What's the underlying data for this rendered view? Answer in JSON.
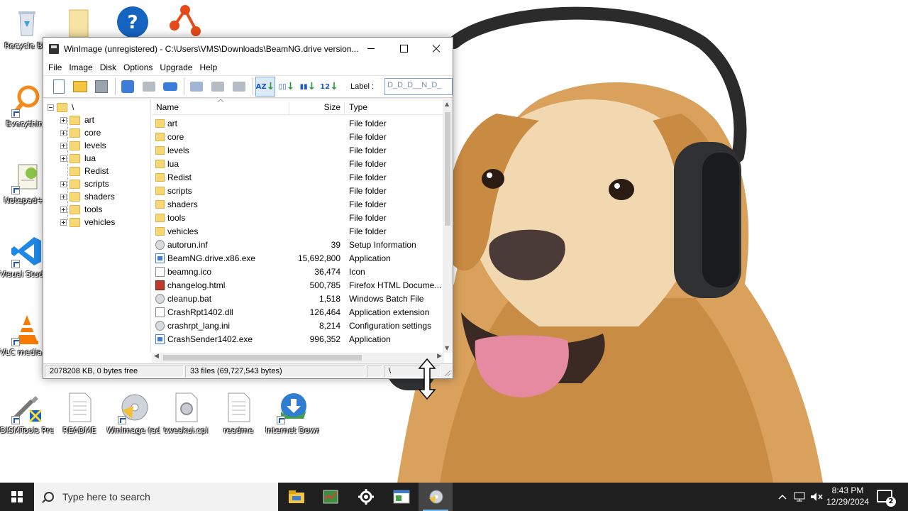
{
  "window": {
    "title": "WinImage (unregistered) - C:\\Users\\VMS\\Downloads\\BeamNG.drive version...",
    "menu": [
      "File",
      "Image",
      "Disk",
      "Options",
      "Upgrade",
      "Help"
    ],
    "label_caption": "Label :",
    "label_value": "D_D_D__N_D_"
  },
  "tree": {
    "root": "\\",
    "items": [
      "art",
      "core",
      "levels",
      "lua",
      "Redist",
      "scripts",
      "shaders",
      "tools",
      "vehicles"
    ]
  },
  "list": {
    "headers": {
      "name": "Name",
      "size": "Size",
      "type": "Type"
    },
    "rows": [
      {
        "name": "art",
        "size": "",
        "type": "File folder",
        "icon": "folder"
      },
      {
        "name": "core",
        "size": "",
        "type": "File folder",
        "icon": "folder"
      },
      {
        "name": "levels",
        "size": "",
        "type": "File folder",
        "icon": "folder"
      },
      {
        "name": "lua",
        "size": "",
        "type": "File folder",
        "icon": "folder"
      },
      {
        "name": "Redist",
        "size": "",
        "type": "File folder",
        "icon": "folder"
      },
      {
        "name": "scripts",
        "size": "",
        "type": "File folder",
        "icon": "folder"
      },
      {
        "name": "shaders",
        "size": "",
        "type": "File folder",
        "icon": "folder"
      },
      {
        "name": "tools",
        "size": "",
        "type": "File folder",
        "icon": "folder"
      },
      {
        "name": "vehicles",
        "size": "",
        "type": "File folder",
        "icon": "folder"
      },
      {
        "name": "autorun.inf",
        "size": "39",
        "type": "Setup Information",
        "icon": "gear"
      },
      {
        "name": "BeamNG.drive.x86.exe",
        "size": "15,692,800",
        "type": "Application",
        "icon": "exe"
      },
      {
        "name": "beamng.ico",
        "size": "36,474",
        "type": "Icon",
        "icon": "file"
      },
      {
        "name": "changelog.html",
        "size": "500,785",
        "type": "Firefox HTML Docume...",
        "icon": "html"
      },
      {
        "name": "cleanup.bat",
        "size": "1,518",
        "type": "Windows Batch File",
        "icon": "gear"
      },
      {
        "name": "CrashRpt1402.dll",
        "size": "126,464",
        "type": "Application extension",
        "icon": "file"
      },
      {
        "name": "crashrpt_lang.ini",
        "size": "8,214",
        "type": "Configuration settings",
        "icon": "gear"
      },
      {
        "name": "CrashSender1402.exe",
        "size": "996,352",
        "type": "Application",
        "icon": "exe"
      }
    ]
  },
  "status": {
    "free": "2078208 KB, 0 bytes free",
    "files": "33 files (69,727,543 bytes)",
    "path": "\\"
  },
  "desktop_icons": [
    {
      "label": "Recycle Bin",
      "icon": "recycle-bin-icon"
    },
    {
      "label": "Everything",
      "icon": "magnifier-icon"
    },
    {
      "label": "Notepad++",
      "icon": "notepad-icon"
    },
    {
      "label": "Visual Studio Code",
      "icon": "vscode-icon"
    },
    {
      "label": "VLC media player",
      "icon": "vlc-icon"
    },
    {
      "label": "DISMTools Preview",
      "icon": "tools-icon"
    },
    {
      "label": "README",
      "icon": "text-file-icon"
    },
    {
      "label": "WinImage (administra...",
      "icon": "winimage-icon"
    },
    {
      "label": "tweakui.cpl",
      "icon": "cpl-file-icon"
    },
    {
      "label": "readme",
      "icon": "text-file-icon"
    },
    {
      "label": "Internet Downlo...",
      "icon": "idm-icon"
    }
  ],
  "taskbar": {
    "search_placeholder": "Type here to search",
    "time": "8:43 PM",
    "date": "12/29/2024",
    "notification_count": "2"
  },
  "colors": {
    "taskbar": "#1f1f1f",
    "folder": "#f7d774",
    "accent": "#3b7dd8"
  }
}
